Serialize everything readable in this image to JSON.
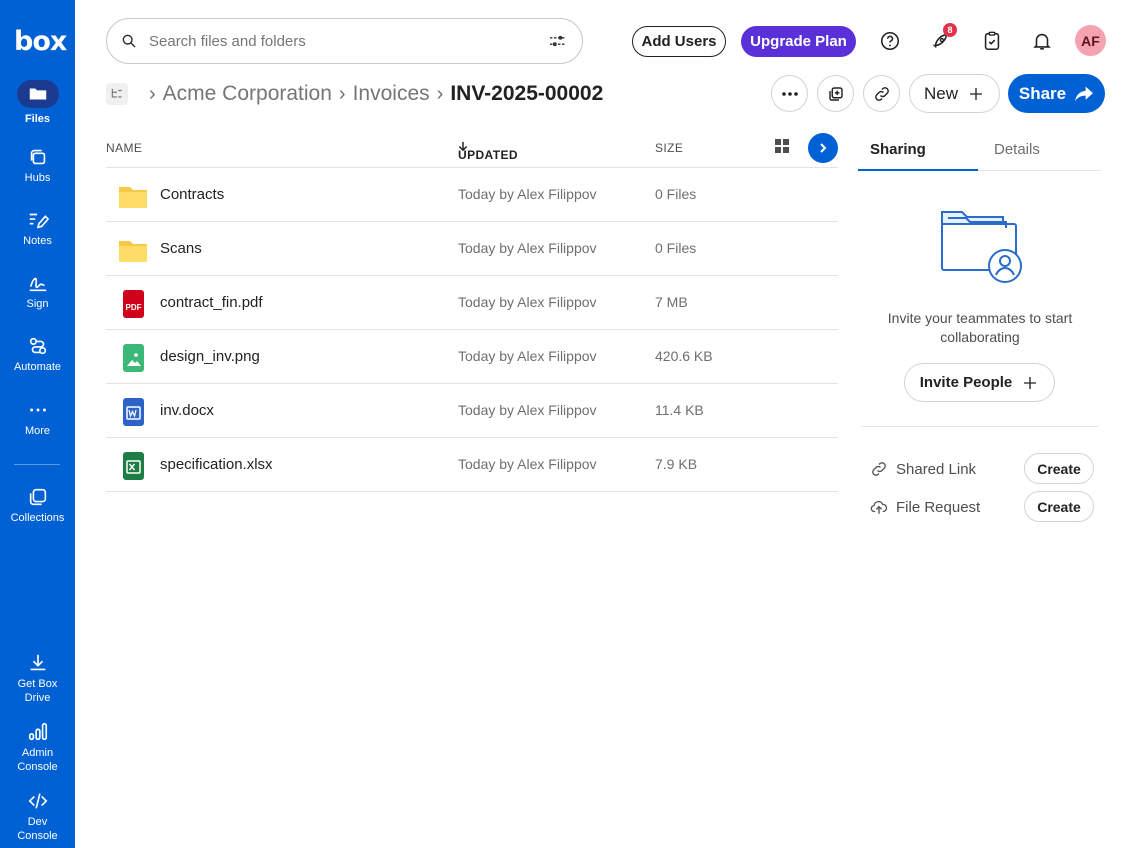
{
  "app": {
    "logo": "box"
  },
  "sidebar": {
    "items": [
      {
        "label": "Files",
        "icon": "folder-icon"
      },
      {
        "label": "Hubs",
        "icon": "hubs-icon"
      },
      {
        "label": "Notes",
        "icon": "notes-icon"
      },
      {
        "label": "Sign",
        "icon": "sign-icon"
      },
      {
        "label": "Automate",
        "icon": "automate-icon"
      },
      {
        "label": "More",
        "icon": "more-icon"
      },
      {
        "label": "Collections",
        "icon": "collections-icon"
      }
    ],
    "bottom": [
      {
        "label": "Get Box Drive",
        "line1": "Get Box",
        "line2": "Drive",
        "icon": "download-icon"
      },
      {
        "label": "Admin Console",
        "line1": "Admin",
        "line2": "Console",
        "icon": "admin-chart-icon"
      },
      {
        "label": "Dev Console",
        "line1": "Dev",
        "line2": "Console",
        "icon": "code-icon"
      }
    ]
  },
  "topbar": {
    "search_placeholder": "Search files and folders",
    "add_users": "Add Users",
    "upgrade_plan": "Upgrade Plan",
    "notification_badge": "8",
    "avatar_initials": "AF"
  },
  "breadcrumb": {
    "items": [
      "Acme Corporation",
      "Invoices"
    ],
    "current": "INV-2025-00002"
  },
  "actions": {
    "new": "New",
    "share": "Share"
  },
  "list": {
    "headers": {
      "name": "NAME",
      "updated": "UPDATED",
      "size": "SIZE"
    },
    "rows": [
      {
        "name": "Contracts",
        "updated": "Today by Alex Filippov",
        "size": "0 Files",
        "type": "folder"
      },
      {
        "name": "Scans",
        "updated": "Today by Alex Filippov",
        "size": "0 Files",
        "type": "folder"
      },
      {
        "name": "contract_fin.pdf",
        "updated": "Today by Alex Filippov",
        "size": "7 MB",
        "type": "pdf"
      },
      {
        "name": "design_inv.png",
        "updated": "Today by Alex Filippov",
        "size": "420.6 KB",
        "type": "image"
      },
      {
        "name": "inv.docx",
        "updated": "Today by Alex Filippov",
        "size": "11.4 KB",
        "type": "word"
      },
      {
        "name": "specification.xlsx",
        "updated": "Today by Alex Filippov",
        "size": "7.9 KB",
        "type": "excel"
      }
    ]
  },
  "panel": {
    "tabs": [
      "Sharing",
      "Details"
    ],
    "invite_text": "Invite your teammates to start collaborating",
    "invite_button": "Invite People",
    "shared_link_label": "Shared Link",
    "file_request_label": "File Request",
    "create_label": "Create"
  },
  "colors": {
    "brand": "#0061d5",
    "upgrade": "#5a31d8",
    "badge": "#e0334b"
  }
}
